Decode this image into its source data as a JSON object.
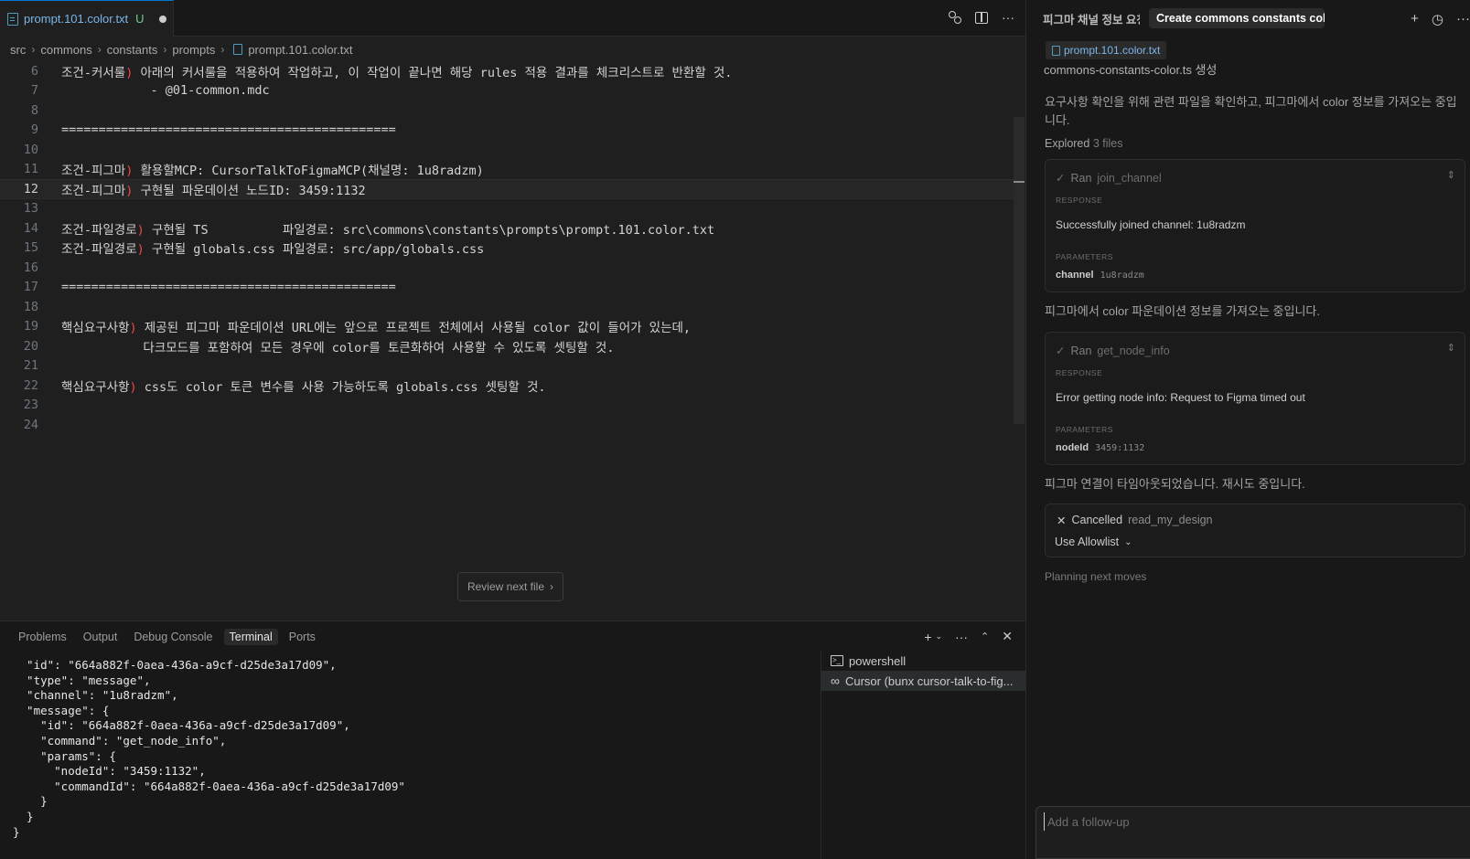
{
  "editor": {
    "tab": {
      "title": "prompt.101.color.txt",
      "flag": "U"
    },
    "breadcrumb": [
      "src",
      "commons",
      "constants",
      "prompts",
      "prompt.101.color.txt"
    ],
    "lines": [
      {
        "num": "6",
        "parts": [
          {
            "t": "조건-커서룰"
          },
          {
            "t": ")",
            "c": "paren"
          },
          {
            "t": " 아래의 커서룰을 적용하여 작업하고, 이 작업이 끝나면 해당 rules 적용 결과를 체크리스트로 반환할 것."
          }
        ]
      },
      {
        "num": "7",
        "parts": [
          {
            "t": "            - @01-common.mdc"
          }
        ]
      },
      {
        "num": "8",
        "parts": []
      },
      {
        "num": "9",
        "parts": [
          {
            "t": "============================================="
          }
        ]
      },
      {
        "num": "10",
        "parts": []
      },
      {
        "num": "11",
        "parts": [
          {
            "t": "조건-피그마"
          },
          {
            "t": ")",
            "c": "paren"
          },
          {
            "t": " 활용할MCP: CursorTalkToFigmaMCP(채널명: 1u8radzm)"
          }
        ]
      },
      {
        "num": "12",
        "parts": [
          {
            "t": "조건-피그마"
          },
          {
            "t": ")",
            "c": "paren"
          },
          {
            "t": " 구현될 파운데이션 노드ID: 3459:1132"
          }
        ]
      },
      {
        "num": "13",
        "parts": []
      },
      {
        "num": "14",
        "parts": [
          {
            "t": "조건-파일경로"
          },
          {
            "t": ")",
            "c": "paren"
          },
          {
            "t": " 구현될 TS          파일경로: src\\commons\\constants\\prompts\\prompt.101.color.txt"
          }
        ]
      },
      {
        "num": "15",
        "parts": [
          {
            "t": "조건-파일경로"
          },
          {
            "t": ")",
            "c": "paren"
          },
          {
            "t": " 구현될 globals.css 파일경로: src/app/globals.css"
          }
        ]
      },
      {
        "num": "16",
        "parts": []
      },
      {
        "num": "17",
        "parts": [
          {
            "t": "============================================="
          }
        ]
      },
      {
        "num": "18",
        "parts": []
      },
      {
        "num": "19",
        "parts": [
          {
            "t": "핵심요구사항"
          },
          {
            "t": ")",
            "c": "paren"
          },
          {
            "t": " 제공된 피그마 파운데이션 URL에는 앞으로 프로젝트 전체에서 사용될 color 값이 들어가 있는데,"
          }
        ]
      },
      {
        "num": "20",
        "parts": [
          {
            "t": "           다크모드를 포함하여 모든 경우에 color를 토큰화하여 사용할 수 있도록 셋팅할 것."
          }
        ]
      },
      {
        "num": "21",
        "parts": []
      },
      {
        "num": "22",
        "parts": [
          {
            "t": "핵심요구사항"
          },
          {
            "t": ")",
            "c": "paren"
          },
          {
            "t": " css도 color 토큰 변수를 사용 가능하도록 globals.css 셋팅할 것."
          }
        ]
      },
      {
        "num": "23",
        "parts": []
      },
      {
        "num": "24",
        "parts": []
      }
    ],
    "current_line": "12",
    "review_button": "Review next file"
  },
  "panel": {
    "tabs": [
      "Problems",
      "Output",
      "Debug Console",
      "Terminal",
      "Ports"
    ],
    "active_tab": "Terminal",
    "terminal_lines": [
      "  \"id\": \"664a882f-0aea-436a-a9cf-d25de3a17d09\",",
      "  \"type\": \"message\",",
      "  \"channel\": \"1u8radzm\",",
      "  \"message\": {",
      "    \"id\": \"664a882f-0aea-436a-a9cf-d25de3a17d09\",",
      "    \"command\": \"get_node_info\",",
      "    \"params\": {",
      "      \"nodeId\": \"3459:1132\",",
      "      \"commandId\": \"664a882f-0aea-436a-a9cf-d25de3a17d09\"",
      "    }",
      "  }",
      "}"
    ],
    "terminals": [
      {
        "icon": "powershell-icon",
        "label": "powershell"
      },
      {
        "icon": "infinity-icon",
        "label": "Cursor (bunx cursor-talk-to-fig..."
      }
    ]
  },
  "chat": {
    "tabs": [
      "피그마 채널 정보 요청",
      "Create commons constants color f"
    ],
    "context_chip": "prompt.101.color.txt",
    "context_desc": "commons-constants-color.ts 생성",
    "msg1": "요구사항 확인을 위해 관련 파일을 확인하고, 피그마에서 color 정보를 가져오는 중입니다.",
    "explored_label": "Explored",
    "explored_count": "3 files",
    "tool1": {
      "ran": "Ran",
      "name": "join_channel",
      "response_label": "RESPONSE",
      "response": "Successfully joined channel: 1u8radzm",
      "params_label": "PARAMETERS",
      "param_key": "channel",
      "param_val": "1u8radzm"
    },
    "msg2": "피그마에서 color 파운데이션 정보를 가져오는 중입니다.",
    "tool2": {
      "ran": "Ran",
      "name": "get_node_info",
      "response_label": "RESPONSE",
      "response": "Error getting node info: Request to Figma timed out",
      "params_label": "PARAMETERS",
      "param_key": "nodeId",
      "param_val": "3459:1132"
    },
    "msg3": "피그마 연결이 타임아웃되었습니다. 재시도 중입니다.",
    "cancel": {
      "label": "Cancelled",
      "name": "read_my_design",
      "allowlist": "Use Allowlist"
    },
    "planning": "Planning next moves",
    "followup_placeholder": "Add a follow-up"
  }
}
